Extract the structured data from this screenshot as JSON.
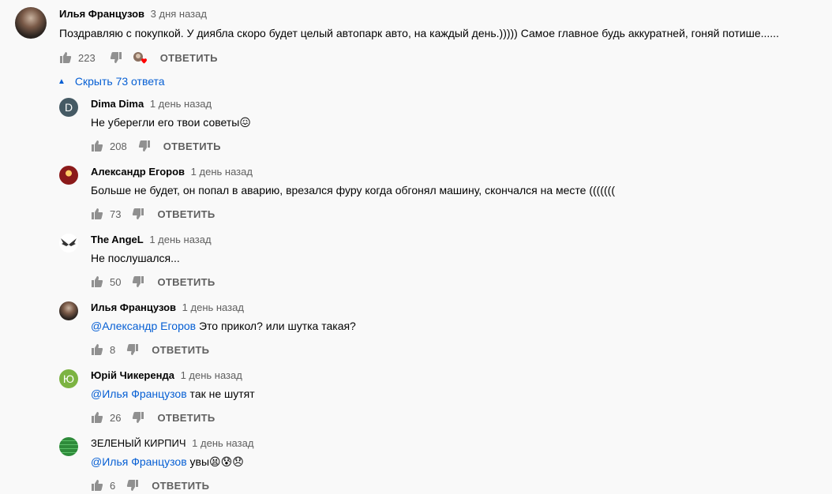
{
  "main_comment": {
    "author": "Илья Французов",
    "time": "3 дня назад",
    "text": "Поздравляю с покупкой. У диябла скоро будет целый автопарк авто, на каждый день.))))) Самое главное будь аккуратней, гоняй потише......",
    "likes": "223",
    "reply_label": "ОТВЕТИТЬ"
  },
  "replies_toggle": {
    "label": "Скрыть 73 ответа",
    "icon": "caret-up-icon"
  },
  "replies": [
    {
      "author": "Dima Dima",
      "time": "1 день назад",
      "mention": "",
      "text": "Не уберегли его твои советы😖",
      "likes": "208",
      "reply_label": "ОТВЕТИТЬ",
      "avatar_letter": "D",
      "avatar_color": "#455a64"
    },
    {
      "author": "Александр Егоров",
      "time": "1 день назад",
      "mention": "",
      "text": "Больше не будет, он попал в аварию, врезался фуру когда обгонял машину, скончался на месте (((((((",
      "likes": "73",
      "reply_label": "ОТВЕТИТЬ",
      "avatar_letter": "",
      "avatar_color": "#8b1a1a"
    },
    {
      "author": "The AngeL",
      "time": "1 день назад",
      "mention": "",
      "text": "Не послушался...",
      "likes": "50",
      "reply_label": "ОТВЕТИТЬ",
      "avatar_letter": "",
      "avatar_color": "#ffffff"
    },
    {
      "author": "Илья Французов",
      "time": "1 день назад",
      "mention": "@Александр Егоров",
      "text": " Это прикол? или шутка такая?",
      "likes": "8",
      "reply_label": "ОТВЕТИТЬ",
      "avatar_letter": "",
      "avatar_color": "#5a4034"
    },
    {
      "author": "Юрій Чикеренда",
      "time": "1 день назад",
      "mention": "@Илья Французов",
      "text": " так не шутят",
      "likes": "26",
      "reply_label": "ОТВЕТИТЬ",
      "avatar_letter": "Ю",
      "avatar_color": "#7cb342"
    },
    {
      "author": "ЗЕЛЕНЫЙ КИРПИЧ",
      "time": "1 день назад",
      "mention": "@Илья Французов",
      "text": " увы😫😰😞",
      "likes": "6",
      "reply_label": "ОТВЕТИТЬ",
      "avatar_letter": "",
      "avatar_color": "#2e8b3a"
    }
  ],
  "colors": {
    "link": "#065fd4",
    "meta": "#606060",
    "text": "#030303",
    "background": "#f9f9f9"
  }
}
